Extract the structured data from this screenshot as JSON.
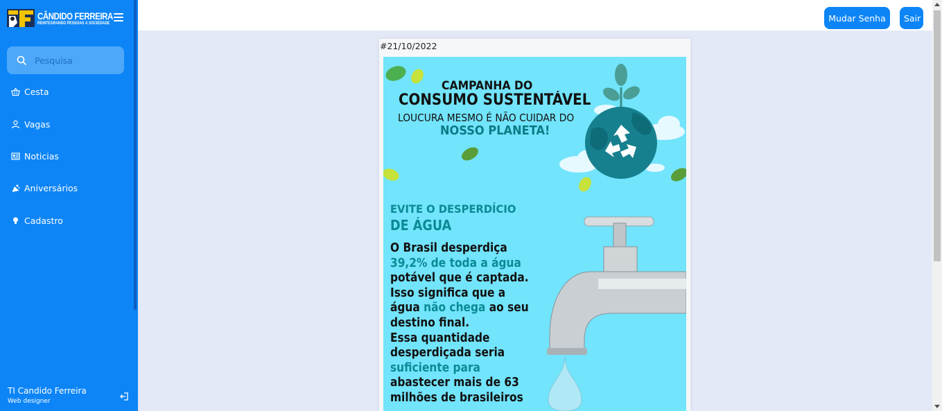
{
  "brand": {
    "name": "CÂNDIDO FERREIRA",
    "tagline": "REINTEGRANDO PESSOAS À SOCIEDADE"
  },
  "search": {
    "placeholder": "Pesquisa"
  },
  "nav": [
    {
      "label": "Cesta",
      "icon": "basket-icon"
    },
    {
      "label": "Vagas",
      "icon": "user-icon"
    },
    {
      "label": "Noticias",
      "icon": "newspaper-icon"
    },
    {
      "label": "Aniversários",
      "icon": "cake-icon"
    },
    {
      "label": "Cadastro",
      "icon": "bulb-icon"
    }
  ],
  "profile": {
    "name": "TI Candido Ferreira",
    "role": "Web designer"
  },
  "topbar": {
    "change_password": "Mudar Senha",
    "logout": "Sair"
  },
  "news": {
    "date": "#21/10/2022",
    "poster": {
      "title1": "CAMPANHA DO",
      "title2": "CONSUMO SUSTENTÁVEL",
      "sub1": "LOUCURA MESMO É NÃO CUIDAR DO",
      "sub2": "NOSSO PLANETA!",
      "heading1": "EVITE  O DESPERDÍCIO",
      "heading2": "DE ÁGUA",
      "body": [
        [
          {
            "t": "O Brasil desperdiça",
            "hl": false
          }
        ],
        [
          {
            "t": "39,2% de toda a água",
            "hl": true
          }
        ],
        [
          {
            "t": "potável que é captada.",
            "hl": false
          }
        ],
        [
          {
            "t": "Isso significa que a",
            "hl": false
          }
        ],
        [
          {
            "t": "água ",
            "hl": false
          },
          {
            "t": "não chega",
            "hl": true
          },
          {
            "t": " ao seu",
            "hl": false
          }
        ],
        [
          {
            "t": "destino final.",
            "hl": false
          }
        ],
        [
          {
            "t": "Essa quantidade",
            "hl": false
          }
        ],
        [
          {
            "t": "desperdiçada seria",
            "hl": false
          }
        ],
        [
          {
            "t": "suficiente para",
            "hl": true
          }
        ],
        [
          {
            "t": "abastecer mais de 63",
            "hl": false
          }
        ],
        [
          {
            "t": "milhões de brasileiros",
            "hl": false
          }
        ]
      ]
    }
  },
  "colors": {
    "primary": "#0d85f7",
    "background": "#e4e9f7",
    "poster_bg": "#72e4fb",
    "accent_teal": "#0a8b96"
  }
}
